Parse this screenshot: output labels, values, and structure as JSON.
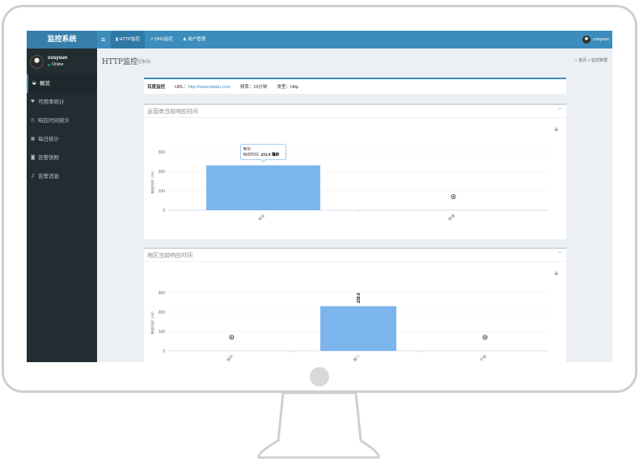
{
  "topbar": {
    "logo": "监控系统",
    "menu_icon": "hamburger-icon",
    "nav": [
      {
        "label": "HTTP监控",
        "icon": "chart-icon",
        "active": true
      },
      {
        "label": "DNS监控",
        "icon": "line-chart-icon",
        "active": false
      },
      {
        "label": "用户管理",
        "icon": "user-icon",
        "active": false
      }
    ],
    "user": "cosysun"
  },
  "sidebar": {
    "user": "cosysun",
    "status": "Online",
    "items": [
      {
        "label": "概览",
        "icon": "dashboard-icon"
      },
      {
        "label": "可用率统计",
        "icon": "heart-icon"
      },
      {
        "label": "响应时间统计",
        "icon": "clock-icon"
      },
      {
        "label": "每日统计",
        "icon": "calendar-icon"
      },
      {
        "label": "告警快照",
        "icon": "camera-icon"
      },
      {
        "label": "告警消息",
        "icon": "bell-icon"
      }
    ]
  },
  "page": {
    "title": "HTTP监控",
    "subtitle": "控制台",
    "breadcrumb_home": "首页",
    "breadcrumb_current": "监控数据"
  },
  "info": {
    "name": "百度监控",
    "url_label": "URL：",
    "url": "http://www.baidu.com",
    "freq": "频率：15分钟",
    "type": "类型：Http"
  },
  "box1": {
    "title": "运营商当前响应时间"
  },
  "box2": {
    "title": "地区当前响应时间"
  },
  "chart_data": [
    {
      "type": "bar",
      "ylabel": "响应时间（ms）",
      "yticks": [
        0,
        100,
        200,
        300
      ],
      "ylim": [
        0,
        300
      ],
      "categories": [
        "电信",
        "联通"
      ],
      "values": [
        231.0,
        null
      ],
      "tooltip": {
        "title": "电信",
        "label": "响应时间",
        "value": "231.0 毫秒"
      }
    },
    {
      "type": "bar",
      "ylabel": "响应时间（ms）",
      "yticks": [
        0,
        100,
        200,
        300
      ],
      "ylim": [
        0,
        300
      ],
      "categories": [
        "福州",
        "厦门",
        "宁德"
      ],
      "values": [
        null,
        230.0,
        null
      ],
      "data_label": "230.0"
    }
  ]
}
